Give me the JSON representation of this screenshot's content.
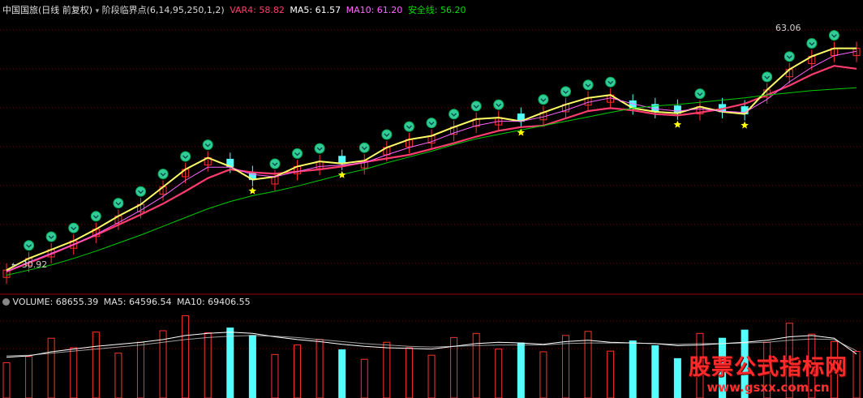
{
  "header": {
    "title": "中国国旅(日线 前复权)",
    "indicator": "阶段临界点(6,14,95,250,1,2)",
    "var4_label": "VAR4: 58.82",
    "ma5_label": "MA5: 61.57",
    "ma10_label": "MA10: 61.20",
    "safe_label": "安全线: 56.20"
  },
  "volume_header": {
    "title": "VOLUME: 68655.39",
    "ma5_label": "MA5: 64596.54",
    "ma10_label": "MA10: 69406.55"
  },
  "price_annotations": {
    "high": "63.06",
    "low": "30.92"
  },
  "watermark": {
    "title": "股票公式指标网",
    "url": "www.gsxx.com.cn"
  },
  "colors": {
    "up": "#ff3030",
    "down": "#54ffff",
    "var4": "#ff3c6e",
    "ma5": "#ffff66",
    "ma10": "#ff66ff",
    "safe": "#00cc00",
    "grid": "#7a0000",
    "star": "#ffff00",
    "badge": "#33cc99"
  },
  "chart_data": [
    {
      "type": "candlestick",
      "title": "中国国旅(日线 前复权)",
      "ylim": [
        28,
        66
      ],
      "grid": true,
      "series": [
        {
          "name": "VAR4",
          "values": [
            31.0,
            32.2,
            33.4,
            34.7,
            36.0,
            37.4,
            38.8,
            40.3,
            42.0,
            43.8,
            45.0,
            44.6,
            44.4,
            44.7,
            45.0,
            45.4,
            46.0,
            46.5,
            47.0,
            47.8,
            48.6,
            49.5,
            50.3,
            50.8,
            51.0,
            52.0,
            53.0,
            53.4,
            53.1,
            52.6,
            52.4,
            52.8,
            53.3,
            54.0,
            55.2,
            56.5,
            58.0,
            59.2,
            58.8
          ]
        },
        {
          "name": "MA5",
          "values": [
            31.2,
            32.8,
            34.0,
            35.2,
            36.8,
            38.6,
            40.2,
            42.6,
            45.0,
            46.6,
            45.4,
            43.6,
            44.0,
            45.4,
            46.1,
            45.8,
            46.2,
            48.0,
            49.1,
            49.6,
            50.8,
            51.9,
            52.1,
            51.6,
            52.8,
            53.9,
            54.8,
            55.2,
            53.4,
            52.9,
            52.7,
            53.6,
            52.9,
            52.6,
            55.9,
            58.7,
            60.5,
            61.6,
            61.6
          ]
        },
        {
          "name": "MA10",
          "values": [
            31.0,
            32.3,
            33.5,
            34.7,
            36.1,
            37.7,
            39.4,
            41.3,
            43.5,
            45.3,
            45.3,
            44.3,
            44.0,
            44.7,
            45.4,
            45.6,
            45.9,
            47.0,
            48.0,
            48.8,
            50.0,
            51.0,
            51.6,
            51.6,
            52.2,
            53.1,
            54.2,
            54.8,
            54.0,
            53.3,
            53.0,
            53.3,
            53.0,
            52.8,
            54.6,
            57.0,
            59.0,
            60.6,
            61.2
          ]
        },
        {
          "name": "安全线",
          "values": [
            30.5,
            31.2,
            31.9,
            32.8,
            33.8,
            34.9,
            36.0,
            37.2,
            38.4,
            39.6,
            40.6,
            41.4,
            42.0,
            42.7,
            43.5,
            44.3,
            45.0,
            45.9,
            46.7,
            47.5,
            48.4,
            49.2,
            49.8,
            50.4,
            51.0,
            51.6,
            52.2,
            52.8,
            53.4,
            53.7,
            53.9,
            54.2,
            54.5,
            54.8,
            55.2,
            55.5,
            55.8,
            56.0,
            56.2
          ]
        }
      ]
    },
    {
      "type": "bar",
      "title": "VOLUME: 68655.39",
      "ylim": [
        0,
        130000
      ],
      "series": [
        {
          "name": "VOLUME",
          "values": [
            52000,
            61000,
            88000,
            74000,
            97000,
            66000,
            82000,
            99000,
            121000,
            96000,
            103000,
            92000,
            64000,
            78000,
            86000,
            71000,
            57000,
            82000,
            74000,
            63000,
            89000,
            95000,
            72000,
            81000,
            68000,
            92000,
            98000,
            69000,
            84000,
            77000,
            58000,
            95000,
            88000,
            100000,
            82000,
            110000,
            94000,
            83000,
            68655
          ]
        },
        {
          "name": "MA5",
          "values": [
            60000,
            62000,
            68000,
            72000,
            76000,
            79000,
            82000,
            86000,
            92000,
            95000,
            97000,
            95000,
            90000,
            86000,
            83000,
            79000,
            76000,
            74000,
            73000,
            72000,
            76000,
            80000,
            82000,
            81000,
            79000,
            83000,
            85000,
            82000,
            81000,
            80000,
            77000,
            78000,
            80000,
            82000,
            85000,
            90000,
            92000,
            88000,
            64597
          ]
        },
        {
          "name": "MA10",
          "values": [
            62000,
            63000,
            66000,
            69000,
            72000,
            75000,
            78000,
            82000,
            86000,
            89000,
            91000,
            92000,
            91000,
            89000,
            86000,
            83000,
            80000,
            78000,
            76000,
            75000,
            76000,
            77000,
            78000,
            78000,
            78000,
            80000,
            81000,
            81000,
            81000,
            80000,
            79000,
            80000,
            80000,
            81000,
            82000,
            85000,
            87000,
            86000,
            69407
          ]
        }
      ]
    }
  ]
}
